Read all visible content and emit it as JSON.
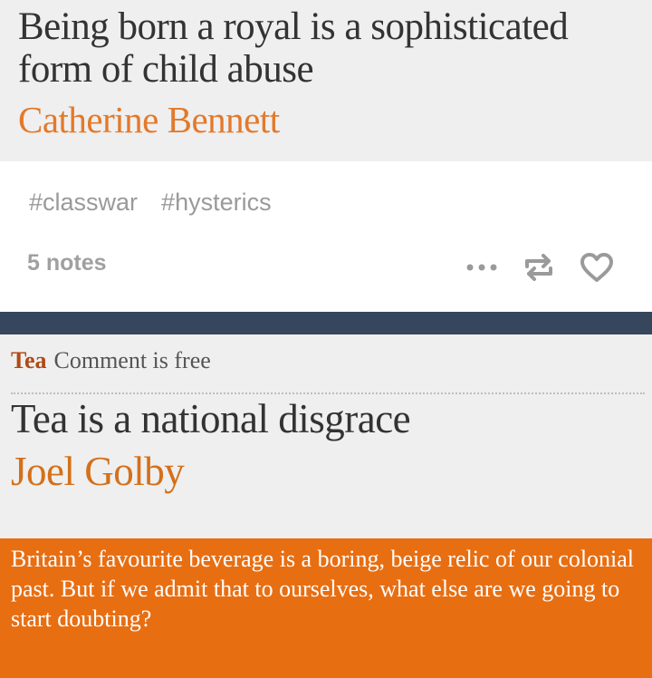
{
  "article_top": {
    "headline": "Being born a royal is a sophisticated form of child abuse",
    "byline": "Catherine Bennett"
  },
  "post": {
    "tags": [
      "#classwar",
      "#hysterics"
    ],
    "notes": "5 notes",
    "actions": {
      "more_icon": "more-dots-icon",
      "reblog_icon": "reblog-icon",
      "like_icon": "heart-icon"
    }
  },
  "article_bottom": {
    "section": "Tea",
    "series": "Comment is free",
    "headline": "Tea is a national disgrace",
    "byline": "Joel Golby",
    "standfirst": "Britain’s favourite beverage is a boring, beige relic of our colonial past. But if we admit that to ourselves, what else are we going to start doubting?"
  },
  "colors": {
    "byline_orange": "#e3792b",
    "standfirst_bg": "#e86e12",
    "divider_bar": "#36465d",
    "section_red": "#b04a16"
  }
}
